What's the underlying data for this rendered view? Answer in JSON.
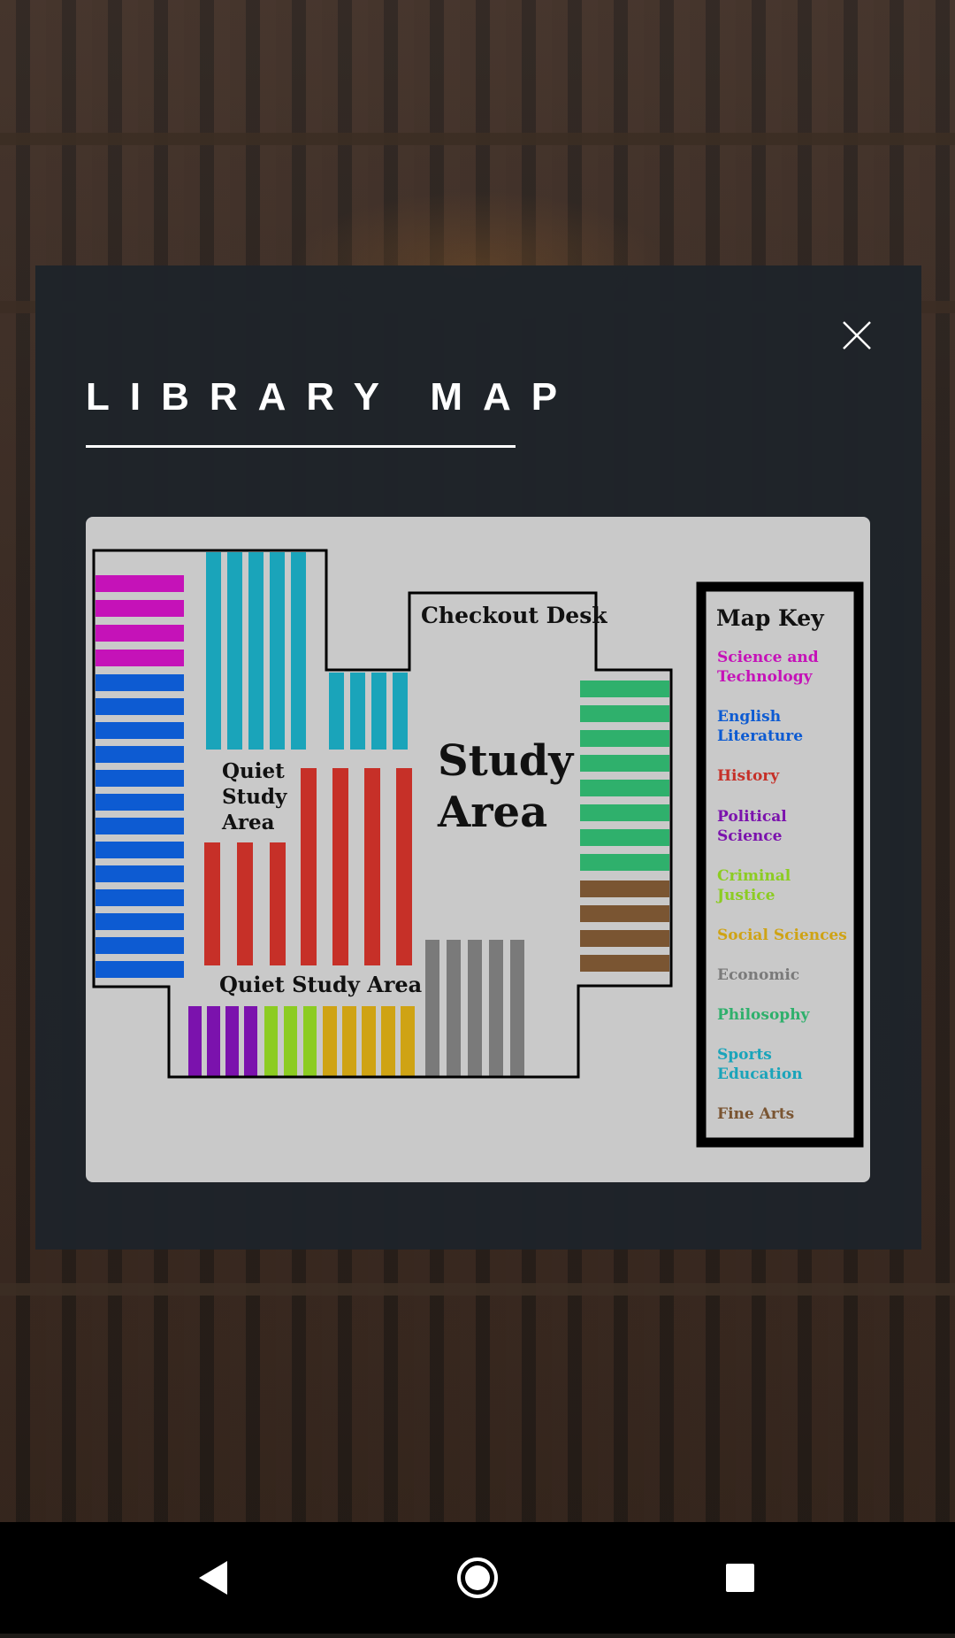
{
  "modal": {
    "title": "LIBRARY MAP"
  },
  "map": {
    "checkout_label": "Checkout Desk",
    "study_area_line1": "Study",
    "study_area_line2": "Area",
    "quiet_study_line1": "Quiet",
    "quiet_study_line2": "Study",
    "quiet_study_line3": "Area",
    "quiet_study_bottom": "Quiet Study Area",
    "key": {
      "title": "Map Key",
      "items": [
        {
          "line1": "Science and",
          "line2": "Technology",
          "color": "#c512b8"
        },
        {
          "line1": "English",
          "line2": "Literature",
          "color": "#0d5bd2"
        },
        {
          "line1": "History",
          "line2": "",
          "color": "#c63028"
        },
        {
          "line1": "Political",
          "line2": "Science",
          "color": "#7b12ad"
        },
        {
          "line1": "Criminal",
          "line2": "Justice",
          "color": "#8ccc22"
        },
        {
          "line1": "Social Sciences",
          "line2": "",
          "color": "#cfa314"
        },
        {
          "line1": "Economic",
          "line2": "",
          "color": "#7a7a7a"
        },
        {
          "line1": "Philosophy",
          "line2": "",
          "color": "#2fb06c"
        },
        {
          "line1": "Sports",
          "line2": "Education",
          "color": "#1aa4ba"
        },
        {
          "line1": "Fine Arts",
          "line2": "",
          "color": "#7a5532"
        }
      ]
    }
  },
  "icons": {
    "close": "close-icon",
    "back": "back-triangle-icon",
    "home": "home-circle-icon",
    "recents": "recents-square-icon"
  }
}
